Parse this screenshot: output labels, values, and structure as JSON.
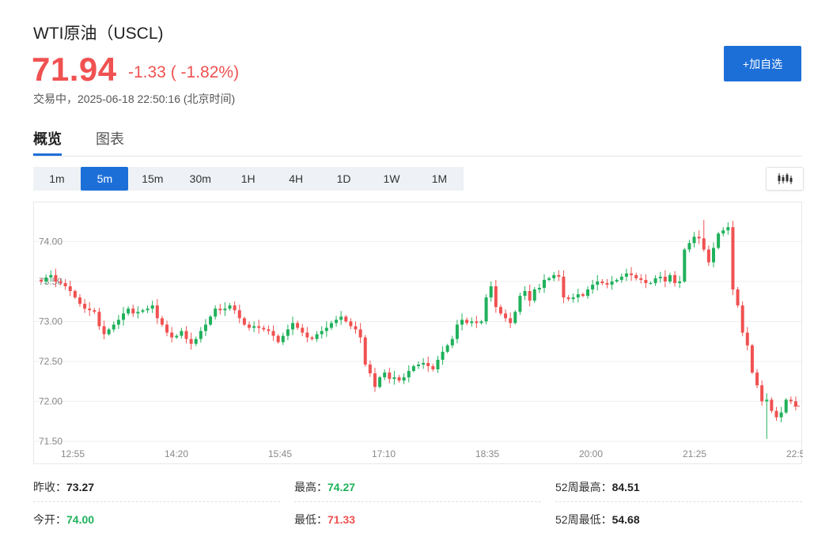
{
  "header": {
    "title": "WTI原油（USCL)",
    "price": "71.94",
    "change": "-1.33 ( -1.82%)",
    "status": "交易中，2025-06-18 22:50:16 (北京时间)",
    "add_button": "+加自选",
    "up_color": "#1fb15b",
    "down_color": "#f05151",
    "accent_color": "#1d6fd8"
  },
  "tabs": [
    {
      "label": "概览",
      "active": true
    },
    {
      "label": "图表",
      "active": false
    }
  ],
  "intervals": [
    {
      "label": "1m",
      "active": false
    },
    {
      "label": "5m",
      "active": true
    },
    {
      "label": "15m",
      "active": false
    },
    {
      "label": "30m",
      "active": false
    },
    {
      "label": "1H",
      "active": false
    },
    {
      "label": "4H",
      "active": false
    },
    {
      "label": "1D",
      "active": false
    },
    {
      "label": "1W",
      "active": false
    },
    {
      "label": "1M",
      "active": false
    }
  ],
  "chart_type_icon": "candlestick-icon",
  "chart_data": {
    "type": "candlestick",
    "y_ticks": [
      "74.00",
      "73.50",
      "73.00",
      "72.50",
      "72.00",
      "71.50"
    ],
    "x_ticks": [
      "12:55",
      "14:20",
      "15:45",
      "17:10",
      "18:35",
      "20:00",
      "21:25",
      "22:5"
    ],
    "ylim": [
      71.48,
      74.41
    ],
    "grid": true,
    "candles_close": [
      73.5,
      73.55,
      73.58,
      73.5,
      73.48,
      73.44,
      73.38,
      73.3,
      73.22,
      73.16,
      73.14,
      73.12,
      72.94,
      72.84,
      72.9,
      72.96,
      73.02,
      73.1,
      73.16,
      73.1,
      73.12,
      73.14,
      73.16,
      73.2,
      73.04,
      72.96,
      72.86,
      72.8,
      72.82,
      72.88,
      72.78,
      72.72,
      72.78,
      72.88,
      72.96,
      73.06,
      73.16,
      73.14,
      73.16,
      73.2,
      73.14,
      73.04,
      72.96,
      72.92,
      72.94,
      72.92,
      72.9,
      72.88,
      72.82,
      72.74,
      72.82,
      72.9,
      72.98,
      72.92,
      72.86,
      72.8,
      72.78,
      72.84,
      72.88,
      72.92,
      72.98,
      73.02,
      73.06,
      73.0,
      72.94,
      72.9,
      72.8,
      72.46,
      72.35,
      72.18,
      72.3,
      72.36,
      72.28,
      72.3,
      72.26,
      72.3,
      72.38,
      72.44,
      72.46,
      72.48,
      72.44,
      72.4,
      72.52,
      72.62,
      72.7,
      72.78,
      72.96,
      73.02,
      72.98,
      73.0,
      72.98,
      73.0,
      73.3,
      73.44,
      73.18,
      73.1,
      73.04,
      72.98,
      73.12,
      73.32,
      73.38,
      73.26,
      73.4,
      73.42,
      73.52,
      73.54,
      73.58,
      73.56,
      73.3,
      73.28,
      73.3,
      73.34,
      73.32,
      73.4,
      73.46,
      73.5,
      73.48,
      73.46,
      73.5,
      73.52,
      73.56,
      73.6,
      73.58,
      73.54,
      73.52,
      73.48,
      73.48,
      73.54,
      73.56,
      73.5,
      73.58,
      73.48,
      73.5,
      73.9,
      73.98,
      74.06,
      74.04,
      73.9,
      73.74,
      73.92,
      74.1,
      74.14,
      74.18,
      73.4,
      73.2,
      72.86,
      72.7,
      72.36,
      72.2,
      72.0,
      72.02,
      71.88,
      71.8,
      71.86,
      72.02,
      72.0,
      71.94
    ],
    "last_price_marker": "71.94"
  },
  "stats": [
    {
      "label": "昨收：",
      "value": "73.27",
      "color": "#222222"
    },
    {
      "label": "最高：",
      "value": "74.27",
      "color": "#1fb15b"
    },
    {
      "label": "52周最高：",
      "value": "84.51",
      "color": "#222222"
    },
    {
      "label": "今开：",
      "value": "74.00",
      "color": "#1fb15b"
    },
    {
      "label": "最低：",
      "value": "71.33",
      "color": "#f05151"
    },
    {
      "label": "52周最低：",
      "value": "54.68",
      "color": "#222222"
    }
  ]
}
